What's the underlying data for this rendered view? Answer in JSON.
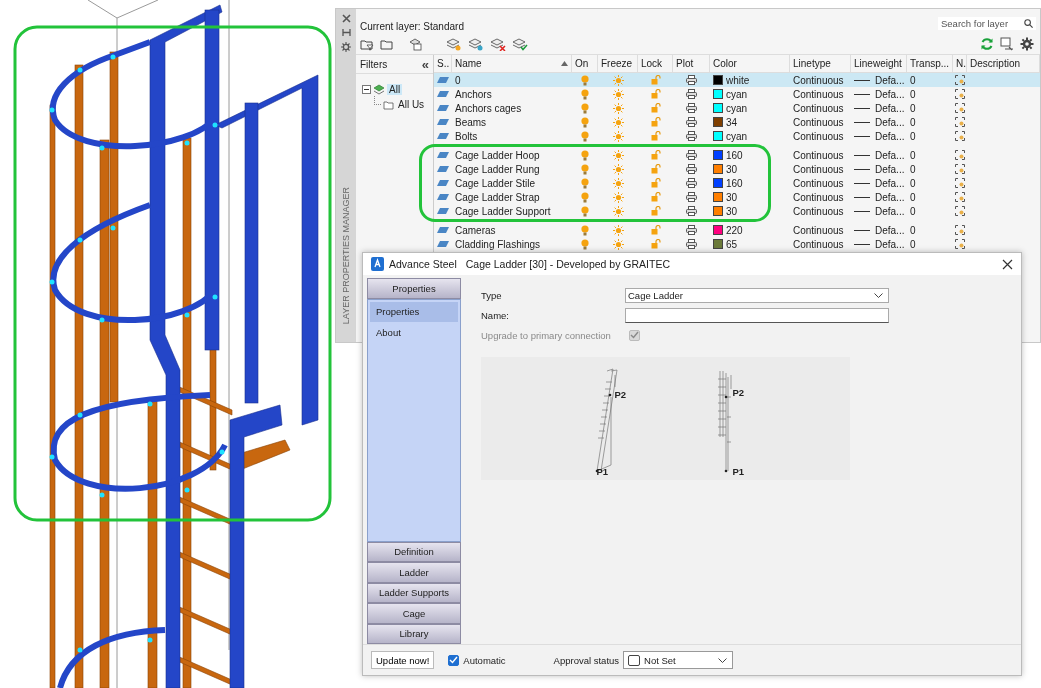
{
  "layer_manager": {
    "side_title": "LAYER PROPERTIES MANAGER",
    "current_layer": "Current layer: Standard",
    "search": {
      "placeholder": "Search for layer"
    },
    "filters": {
      "title": "Filters",
      "collapse_glyph": "«",
      "tree": [
        {
          "label": "All",
          "selected": true,
          "expanded": true,
          "children": [
            {
              "label": "All Us",
              "selected": false
            }
          ]
        }
      ]
    },
    "columns": [
      "S..",
      "Name",
      "On",
      "Freeze",
      "Lock",
      "Plot",
      "Color",
      "Linetype",
      "Lineweight",
      "Transp...",
      "N.",
      "Description"
    ],
    "rows": [
      {
        "name": "0",
        "selected": true,
        "color": "#000000",
        "color_label": "white",
        "linetype": "Continuous",
        "lineweight": "Defa...",
        "transparency": "0"
      },
      {
        "name": "Anchors",
        "selected": false,
        "color": "#00ffff",
        "color_label": "cyan",
        "linetype": "Continuous",
        "lineweight": "Defa...",
        "transparency": "0"
      },
      {
        "name": "Anchors cages",
        "selected": false,
        "color": "#00ffff",
        "color_label": "cyan",
        "linetype": "Continuous",
        "lineweight": "Defa...",
        "transparency": "0"
      },
      {
        "name": "Beams",
        "selected": false,
        "color": "#7f3f00",
        "color_label": "34",
        "linetype": "Continuous",
        "lineweight": "Defa...",
        "transparency": "0"
      },
      {
        "name": "Bolts",
        "selected": false,
        "color": "#00ffff",
        "color_label": "cyan",
        "linetype": "Continuous",
        "lineweight": "Defa...",
        "transparency": "0"
      },
      {
        "name": "Cage Ladder Hoop",
        "selected": false,
        "color": "#0040ff",
        "color_label": "160",
        "linetype": "Continuous",
        "lineweight": "Defa...",
        "transparency": "0"
      },
      {
        "name": "Cage Ladder Rung",
        "selected": false,
        "color": "#ff7f00",
        "color_label": "30",
        "linetype": "Continuous",
        "lineweight": "Defa...",
        "transparency": "0"
      },
      {
        "name": "Cage Ladder Stile",
        "selected": false,
        "color": "#0040ff",
        "color_label": "160",
        "linetype": "Continuous",
        "lineweight": "Defa...",
        "transparency": "0"
      },
      {
        "name": "Cage Ladder Strap",
        "selected": false,
        "color": "#ff7f00",
        "color_label": "30",
        "linetype": "Continuous",
        "lineweight": "Defa...",
        "transparency": "0"
      },
      {
        "name": "Cage Ladder Support",
        "selected": false,
        "color": "#ff7f00",
        "color_label": "30",
        "linetype": "Continuous",
        "lineweight": "Defa...",
        "transparency": "0"
      },
      {
        "name": "Cameras",
        "selected": false,
        "color": "#ff007f",
        "color_label": "220",
        "linetype": "Continuous",
        "lineweight": "Defa...",
        "transparency": "0"
      },
      {
        "name": "Cladding Flashings",
        "selected": false,
        "color": "#6b7a3a",
        "color_label": "65",
        "linetype": "Continuous",
        "lineweight": "Defa...",
        "transparency": "0"
      }
    ]
  },
  "dialog": {
    "app": "Advance Steel",
    "title": "Cage Ladder [30] - Developed by GRAITEC",
    "nav_header": "Properties",
    "nav_items": [
      {
        "label": "Properties",
        "selected": true
      },
      {
        "label": "About",
        "selected": false
      }
    ],
    "sections": [
      "Definition",
      "Ladder",
      "Ladder Supports",
      "Cage",
      "Library"
    ],
    "type_label": "Type",
    "type_value": "Cage Ladder",
    "name_label": "Name:",
    "upgrade": {
      "label": "Upgrade to primary connection",
      "checked": true,
      "disabled": true
    },
    "previews": [
      {
        "kind": "inclined",
        "top": "P2",
        "bottom": "P1"
      },
      {
        "kind": "vertical",
        "top": "P2",
        "bottom": "P1"
      }
    ],
    "update_button": "Update now!",
    "automatic": {
      "label": "Automatic",
      "checked": true
    },
    "approval_label": "Approval status",
    "approval_value": "Not Set"
  }
}
